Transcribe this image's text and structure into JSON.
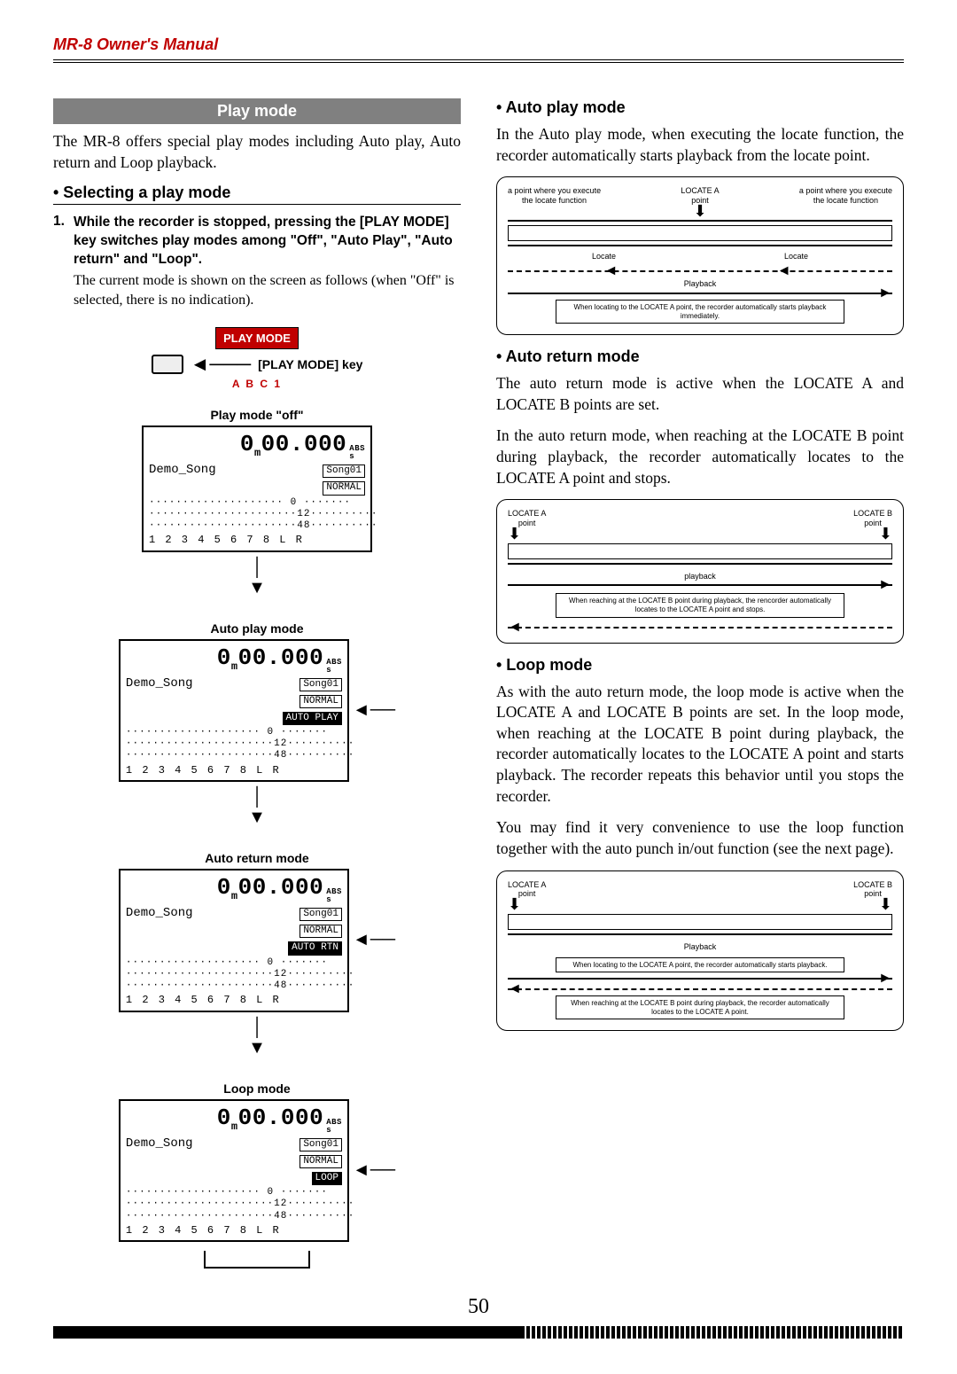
{
  "header": {
    "title": "MR-8 Owner's Manual"
  },
  "page_number": "50",
  "left": {
    "banner": "Play mode",
    "intro": "The MR-8 offers special play modes including Auto play, Auto return and Loop playback.",
    "select_heading": "• Selecting a play mode",
    "step_num": "1.",
    "step_bold": "While the recorder is stopped, pressing the [PLAY MODE] key switches play modes among \"Off\", \"Auto Play\", \"Auto return\" and \"Loop\".",
    "step_plain": "The current mode is shown on the screen as follows (when \"Off\" is selected, there is no indication).",
    "btn_label": "PLAY MODE",
    "key_label": "[PLAY MODE] key",
    "abc": "A B C 1",
    "mode_labels": {
      "off": "Play mode \"off\"",
      "auto_play": "Auto play mode",
      "auto_return": "Auto return mode",
      "loop": "Loop mode"
    },
    "lcd_common": {
      "time_main": "0",
      "time_rest": "00.000",
      "abs_top": "ABS",
      "abs_bot": "s",
      "song_name": "Demo_Song",
      "song_num": "Song01",
      "normal": "NORMAL",
      "tracks": "1 2 3 4 5 6 7 8    L R",
      "dots1": "···················· 0 ·······",
      "dots2": "······················12··········",
      "dots3": "······················48··········"
    },
    "lcd_badges": {
      "auto_play": "AUTO PLAY",
      "auto_rtn": "AUTO RTN",
      "loop": "LOOP"
    }
  },
  "right": {
    "auto_play": {
      "heading": "• Auto play mode",
      "body": "In the Auto play mode, when executing the locate function, the recorder automatically starts playback from the locate point.",
      "diag": {
        "locate_a": "LOCATE A\npoint",
        "exec_label": "a point where you execute\nthe locate function",
        "locate_text": "Locate",
        "playback": "Playback",
        "note": "When locating to the LOCATE A point, the recorder automatically starts playback immediately."
      }
    },
    "auto_return": {
      "heading": "• Auto return mode",
      "body1": "The auto return mode is active when the LOCATE A and LOCATE B points are set.",
      "body2": "In the auto return mode, when reaching at the LOCATE B point during playback, the recorder automatically locates to the LOCATE A point and stops.",
      "diag": {
        "locate_a": "LOCATE A\npoint",
        "locate_b": "LOCATE B\npoint",
        "playback": "playback",
        "note": "When reaching at the LOCATE B point during playback, the rencorder automatically locates to the LOCATE A point and stops."
      }
    },
    "loop": {
      "heading": "• Loop mode",
      "body1": "As with the auto return mode, the loop mode is active when the LOCATE A and LOCATE B points are set.  In the loop mode, when reaching at the LOCATE B point during playback, the recorder automatically locates to the LOCATE A point and starts playback. The recorder repeats this behavior until you stops the recorder.",
      "body2": "You may find it very convenience to use the loop function together with the auto punch in/out function (see the next page).",
      "diag": {
        "locate_a": "LOCATE A\npoint",
        "locate_b": "LOCATE B\npoint",
        "playback": "Playback",
        "note1": "When locating to the LOCATE A point, the recorder automatically starts playback.",
        "note2": "When reaching at the LOCATE B point during playback, the recorder automatically locates to the LOCATE A point."
      }
    }
  }
}
